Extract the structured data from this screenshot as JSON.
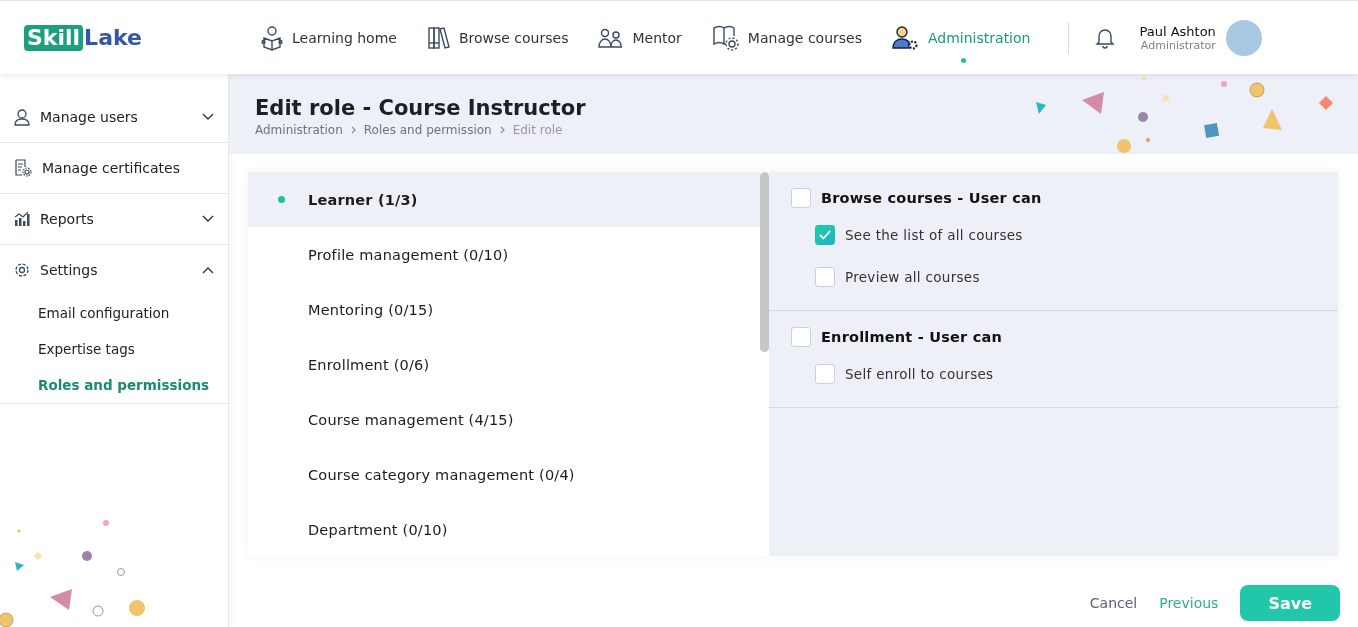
{
  "header": {
    "logo": {
      "part_1": "Skill",
      "part_2": "Lake"
    },
    "nav": [
      {
        "label": "Learning home",
        "selected": false
      },
      {
        "label": "Browse courses",
        "selected": false
      },
      {
        "label": "Mentor",
        "selected": false
      },
      {
        "label": "Manage courses",
        "selected": false
      },
      {
        "label": "Administration",
        "selected": true
      }
    ],
    "user": {
      "name": "Paul Ashton",
      "role": "Administrator"
    }
  },
  "sidebar": {
    "items": [
      {
        "label": "Manage users",
        "kind": "expandable",
        "expanded": false
      },
      {
        "label": "Manage certificates",
        "kind": "link"
      },
      {
        "label": "Reports",
        "kind": "expandable",
        "expanded": false
      },
      {
        "label": "Settings",
        "kind": "expandable",
        "expanded": true,
        "children": [
          {
            "label": "Email configuration",
            "selected": false
          },
          {
            "label": "Expertise tags",
            "selected": false
          },
          {
            "label": "Roles and permissions",
            "selected": true
          }
        ]
      }
    ]
  },
  "page": {
    "title": "Edit role - Course Instructor",
    "breadcrumb": [
      "Administration",
      "Roles and permission",
      "Edit role"
    ]
  },
  "categories": [
    {
      "label": "Learner (1/3)",
      "selected": true
    },
    {
      "label": "Profile management (0/10)",
      "selected": false
    },
    {
      "label": "Mentoring (0/15)",
      "selected": false
    },
    {
      "label": "Enrollment (0/6)",
      "selected": false
    },
    {
      "label": "Course management (4/15)",
      "selected": false
    },
    {
      "label": "Course category management (0/4)",
      "selected": false
    },
    {
      "label": "Department (0/10)",
      "selected": false
    }
  ],
  "permission_groups": [
    {
      "label": "Browse courses - User can",
      "checked": false,
      "permissions": [
        {
          "label": "See the list of all courses",
          "checked": true
        },
        {
          "label": "Preview all courses",
          "checked": false
        }
      ]
    },
    {
      "label": "Enrollment - User can",
      "checked": false,
      "permissions": [
        {
          "label": "Self enroll to courses",
          "checked": false
        }
      ]
    }
  ],
  "footer": {
    "cancel": "Cancel",
    "previous": "Previous",
    "save": "Save"
  }
}
